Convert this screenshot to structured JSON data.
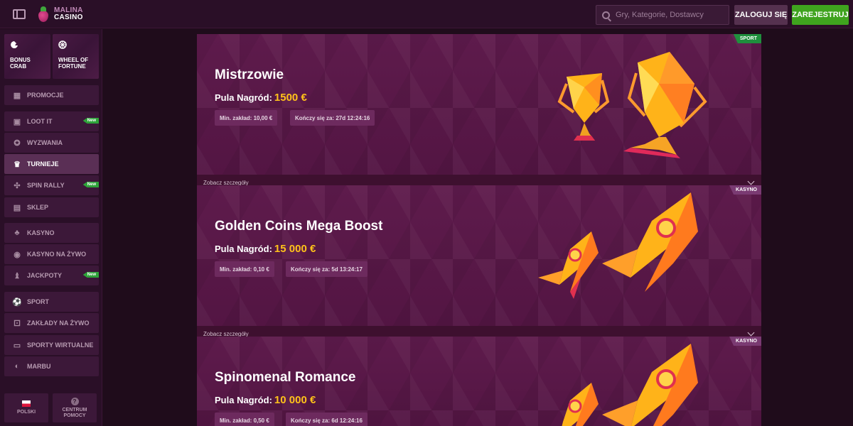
{
  "header": {
    "logo_line1": "MALINA",
    "logo_line2": "CASINO",
    "search_placeholder": "Gry, Kategorie, Dostawcy",
    "login_label": "ZALOGUJ SIĘ",
    "register_label": "ZAREJESTRUJ",
    "accent_login": "#55314f",
    "accent_register": "#3fa31e"
  },
  "sidebar": {
    "tiles": [
      {
        "label": "BONUS CRAB",
        "icon": "crab-icon"
      },
      {
        "label": "WHEEL OF FORTUNE",
        "icon": "wheel-icon"
      }
    ],
    "items": [
      {
        "label": "PROMOCJE",
        "icon": "gift-icon"
      },
      {
        "label": "LOOT IT",
        "icon": "loot-box-icon",
        "badge": "New"
      },
      {
        "label": "WYZWANIA",
        "icon": "medal-icon"
      },
      {
        "label": "TURNIEJE",
        "icon": "trophy-icon",
        "active": true
      },
      {
        "label": "SPIN RALLY",
        "icon": "spin-rally-icon",
        "badge": "New"
      },
      {
        "label": "SKLEP",
        "icon": "shop-icon"
      },
      {
        "label": "KASYNO",
        "icon": "cherries-icon"
      },
      {
        "label": "KASYNO NA ŻYWO",
        "icon": "roulette-icon"
      },
      {
        "label": "JACKPOTY",
        "icon": "jackpot-icon",
        "badge": "New"
      },
      {
        "label": "SPORT",
        "icon": "ball-icon"
      },
      {
        "label": "ZAKŁADY NA ŻYWO",
        "icon": "live-bet-icon"
      },
      {
        "label": "SPORTY WIRTUALNE",
        "icon": "virtual-sport-icon"
      },
      {
        "label": "MARBU",
        "icon": "marbu-icon"
      }
    ],
    "bottom": [
      {
        "label": "POLSKI",
        "icon": "poland-flag-icon"
      },
      {
        "label": "CENTRUM POMOCY",
        "icon": "help-icon"
      }
    ]
  },
  "tournaments": [
    {
      "tag": "SPORT",
      "tag_color": "#1f8f3d",
      "title": "Mistrzowie",
      "prize_label": "Pula Nagród:",
      "prize_amount": "1500 €",
      "min_bet": "Min. zakład: 10,00 €",
      "ends_in": "Kończy się za: 27d 12:24:16",
      "details": "Zobacz szczegóły",
      "art": "trophies-icon"
    },
    {
      "tag": "KASYNO",
      "tag_color": "#7a3a72",
      "title": "Golden Coins Mega Boost",
      "prize_label": "Pula Nagród:",
      "prize_amount": "15 000 €",
      "min_bet": "Min. zakład: 0,10 €",
      "ends_in": "Kończy się za: 5d 13:24:17",
      "details": "Zobacz szczegóły",
      "art": "rockets-icon"
    },
    {
      "tag": "KASYNO",
      "tag_color": "#7a3a72",
      "title": "Spinomenal Romance",
      "prize_label": "Pula Nagród:",
      "prize_amount": "10 000 €",
      "min_bet": "Min. zakład: 0,50 €",
      "ends_in": "Kończy się za: 6d 12:24:16",
      "details": "Zobacz szczegóły",
      "art": "rockets-icon"
    }
  ]
}
